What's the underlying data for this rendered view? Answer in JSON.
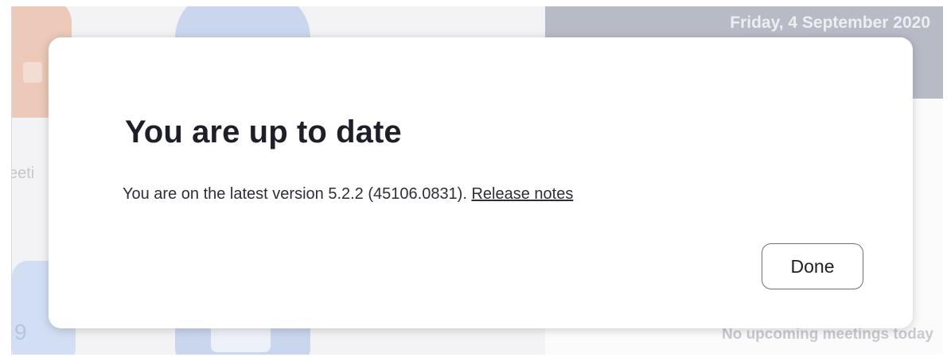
{
  "background": {
    "date": "Friday, 4 September 2020",
    "no_meetings": "No upcoming meetings today",
    "side_label": "eeti",
    "tile_glyph": "9",
    "video_icon": "video-camera-icon"
  },
  "dialog": {
    "title": "You are up to date",
    "message": "You are on the latest version 5.2.2 (45106.0831).",
    "release_notes_link": "Release notes",
    "done_button": "Done"
  }
}
